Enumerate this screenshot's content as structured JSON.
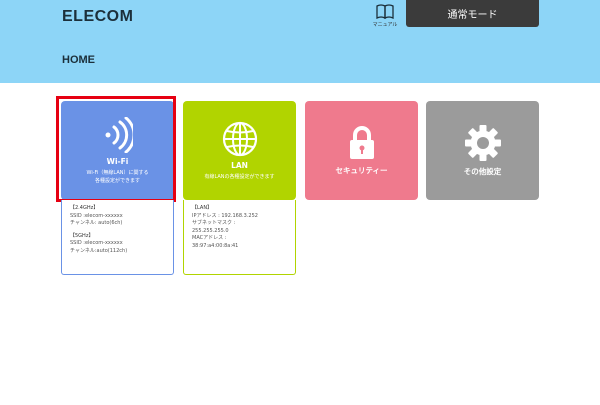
{
  "header": {
    "logo": "ELECOM",
    "manual_label": "マニュアル",
    "mode_button": "通常モード"
  },
  "page": {
    "title": "HOME"
  },
  "tiles": {
    "wifi": {
      "title": "Wi-Fi",
      "desc": "Wi-Fi（無線LAN）に関する\n各種設定ができます"
    },
    "lan": {
      "title": "LAN",
      "desc": "有線LANの各種設定ができます"
    },
    "security": {
      "title": "セキュリティー"
    },
    "other": {
      "title": "その他設定"
    }
  },
  "wifi_info": {
    "band1": {
      "header": "【2.4GHz】",
      "ssid": "SSID :elecom-xxxxxx",
      "channel": "チャンネル: auto(6ch)"
    },
    "band2": {
      "header": "【5GHz】",
      "ssid": "SSID :elecom-xxxxxx",
      "channel": "チャンネル:auto(112ch)"
    }
  },
  "lan_info": {
    "header": "【LAN】",
    "ip": "IPアドレス : 192.168.3.252",
    "subnet_label": "サブネットマスク :",
    "subnet": "255.255.255.0",
    "mac_label": "MACアドレス :",
    "mac": "38:97:a4:00:8a:41"
  },
  "colors": {
    "header_bg": "#8dd5f7",
    "wifi": "#6a92e6",
    "lan": "#b1d400",
    "security": "#ef7a8d",
    "other": "#9b9b9b",
    "highlight": "#e60012"
  },
  "icons": {
    "manual": "book-icon",
    "wifi": "wifi-signal-icon",
    "lan": "globe-icon",
    "security": "lock-icon",
    "other": "gear-icon"
  }
}
